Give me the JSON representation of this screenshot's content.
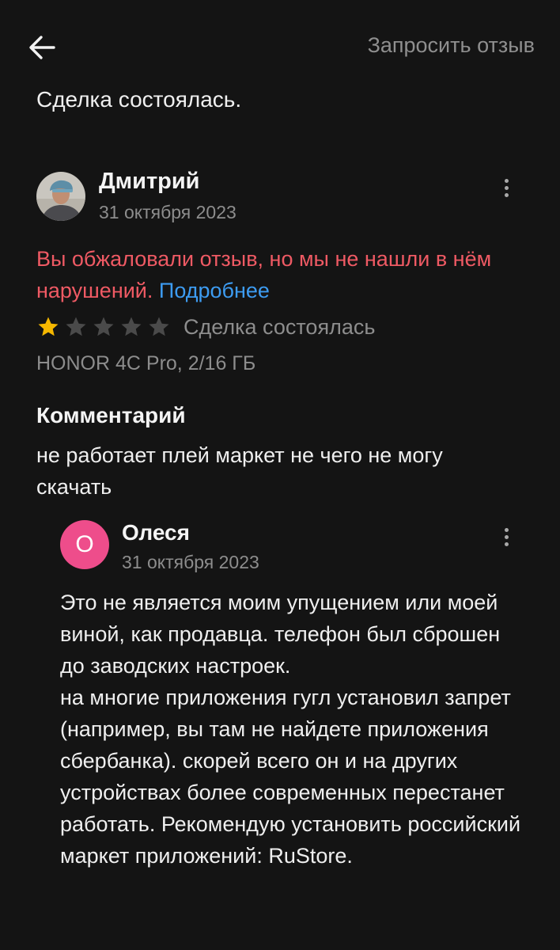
{
  "header": {
    "back_icon": "arrow-left-icon",
    "request_review_label": "Запросить отзыв"
  },
  "deal_status": "Сделка состоялась.",
  "review": {
    "author": "Дмитрий",
    "date": "31 октября 2023",
    "dispute_notice": "Вы обжаловали отзыв, но мы не нашли в нём нарушений.",
    "more_link": "Подробнее",
    "rating": 1,
    "rating_max": 5,
    "rating_label": "Сделка состоялась",
    "product": "HONOR 4C Pro, 2/16 ГБ",
    "comment_title": "Комментарий",
    "comment_text": "не работает плей маркет не чего не могу скачать"
  },
  "reply": {
    "avatar_letter": "О",
    "author": "Олеся",
    "date": "31 октября 2023",
    "text": "Это не является моим упущением или моей виной, как продавца. телефон был сброшен до заводских настроек.\nна многие приложения гугл установил запрет (например, вы там не найдете приложения сбербанка). скорей всего он и на других устройствах более современных перестанет работать. Рекомендую установить российский маркет приложений: RuStore."
  },
  "colors": {
    "background": "#141414",
    "dispute_red": "#ef5a64",
    "link_blue": "#3d9cf2",
    "star_filled": "#f6b800",
    "star_empty": "#4a4a4a",
    "reply_avatar": "#ee4d8b",
    "secondary_text": "#8d8d8d"
  }
}
